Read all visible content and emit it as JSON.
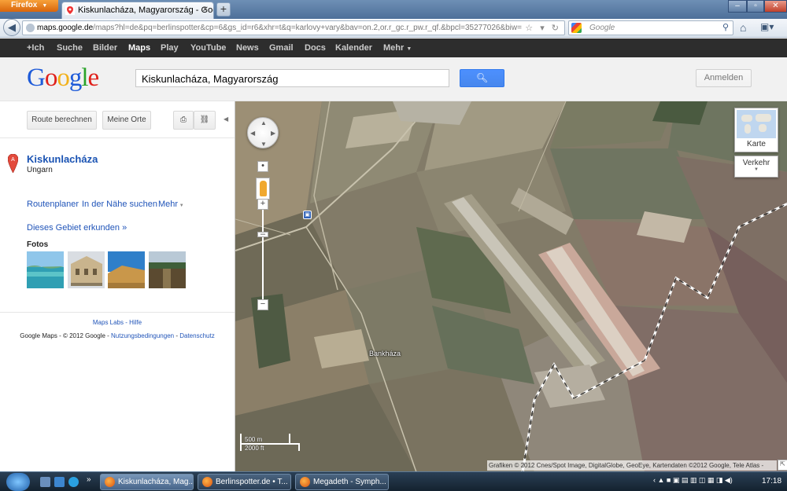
{
  "browser": {
    "app_button": "Firefox",
    "tab_title": "Kiskunlacháza, Magyarország - Google ...",
    "url_domain": "maps.google.de",
    "url_prefix": "",
    "url_rest": "/maps?hl=de&pq=berlinspotter&cp=6&gs_id=r6&xhr=t&q=karlovy+vary&bav=on.2,or.r_gc.r_pw.r_qf.&bpcl=35277026&biw=1280&b",
    "search_placeholder": "Google"
  },
  "gbar": {
    "items": [
      "+Ich",
      "Suche",
      "Bilder",
      "Maps",
      "Play",
      "YouTube",
      "News",
      "Gmail",
      "Docs",
      "Kalender",
      "Mehr"
    ],
    "active": "Maps"
  },
  "header": {
    "search_value": "Kiskunlacháza, Magyarország",
    "signin_label": "Anmelden"
  },
  "panel": {
    "route_button": "Route berechnen",
    "my_places_button": "Meine Orte",
    "marker_letter": "A",
    "place_name": "Kiskunlacháza",
    "place_country": "Ungarn",
    "actions": [
      "Routenplaner",
      "In der Nähe suchen",
      "Mehr"
    ],
    "explore_link": "Dieses Gebiet erkunden »",
    "photos_title": "Fotos",
    "footer_links": "Maps Labs - Hilfe",
    "footer_copyright": "Google Maps - © 2012 Google - ",
    "footer_terms": "Nutzungsbedingungen",
    "footer_sep": " - ",
    "footer_privacy": "Datenschutz"
  },
  "map": {
    "map_type_label": "Karte",
    "traffic_label": "Verkehr",
    "place_label": "Bankháza",
    "scale_metric": "500 m",
    "scale_imperial": "2000 ft",
    "attribution": "Grafiken © 2012 Cnes/Spot Image, DigitalGlobe, GeoEye, Kartendaten ©2012 Google, Tele Atlas -"
  },
  "taskbar": {
    "tasks": [
      "Kiskunlacháza, Mag...",
      "Berlinspotter.de • T...",
      "Megadeth - Symph..."
    ],
    "clock": "17:18"
  },
  "colors": {
    "link": "#2155b9",
    "search_button": "#4d90fe",
    "gbar": "#2d2d2d"
  }
}
